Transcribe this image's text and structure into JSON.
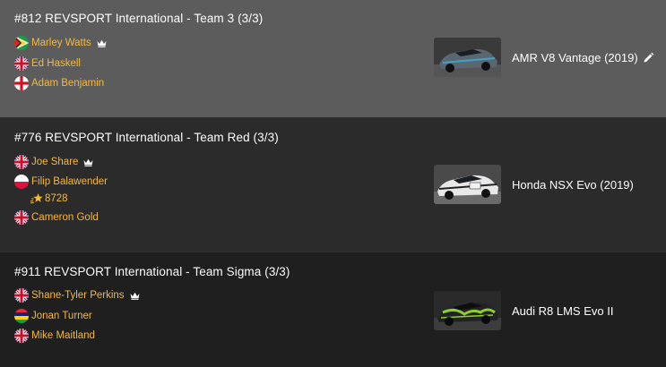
{
  "entries": [
    {
      "title": "#812 REVSPORT International - Team 3 (3/3)",
      "drivers": [
        {
          "name": "Marley Watts",
          "flag": "guyana",
          "captain": true
        },
        {
          "name": "Ed Haskell",
          "flag": "uk",
          "captain": false
        },
        {
          "name": "Adam Benjamin",
          "flag": "england",
          "captain": false
        }
      ],
      "car": "AMR V8 Vantage (2019)",
      "editable": true
    },
    {
      "title": "#776 REVSPORT International - Team Red (3/3)",
      "drivers": [
        {
          "name": "Joe Share",
          "flag": "uk",
          "captain": true
        },
        {
          "name": "Filip Balawender",
          "flag": "poland",
          "captain": false,
          "rating": "8728"
        },
        {
          "name": "Cameron Gold",
          "flag": "uk",
          "captain": false
        }
      ],
      "car": "Honda NSX Evo (2019)",
      "editable": false
    },
    {
      "title": "#911 REVSPORT International - Team Sigma (3/3)",
      "drivers": [
        {
          "name": "Shane-Tyler Perkins",
          "flag": "uk",
          "captain": true
        },
        {
          "name": "Jonan Turner",
          "flag": "mauritius",
          "captain": false
        },
        {
          "name": "Mike Maitland",
          "flag": "uk",
          "captain": false
        }
      ],
      "car": "Audi R8 LMS Evo II",
      "editable": false
    }
  ],
  "colors": {
    "driver_name": "#f5b93e",
    "highlight_row_bg": "#5c5c5c",
    "row_bg": "#2b2b2b",
    "row_bg_dark": "#1f1f1f"
  }
}
